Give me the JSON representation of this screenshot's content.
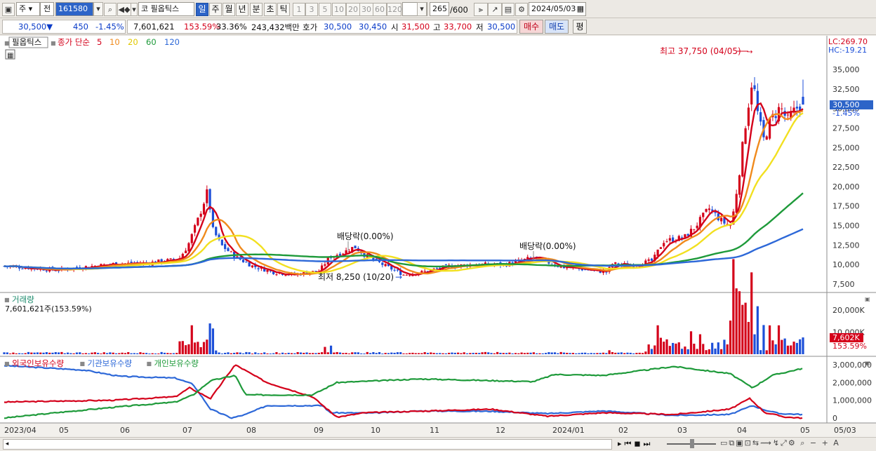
{
  "toolbar": {
    "market": "주",
    "mode": "전",
    "code": "161580",
    "market_tag": "코",
    "stock_name": "필옵틱스",
    "periods": [
      "일",
      "주",
      "월",
      "년",
      "분",
      "초",
      "틱"
    ],
    "active_period": "일",
    "intervals": [
      "1",
      "3",
      "5",
      "10",
      "20",
      "30",
      "60",
      "120"
    ],
    "count": "265",
    "count_total": "/600",
    "date": "2024/05/03"
  },
  "quote": {
    "price": "30,500",
    "arrow": "▼",
    "change": "450",
    "change_pct": "-1.45%",
    "volume": "7,601,621",
    "volume_ratio": "153.59%",
    "turnover": "33.36%",
    "amount": "243,432백만",
    "bid_label": "호가",
    "ask": "30,500",
    "bid": "30,450",
    "open_label": "시",
    "open": "31,500",
    "high_label": "고",
    "high": "33,700",
    "low_label": "저",
    "low": "30,500",
    "buy_label": "매수",
    "sell_label": "매도",
    "eval_label": "평"
  },
  "price_panel": {
    "title": "필옵틱스",
    "ma_label": "종가 단순",
    "ma_periods": [
      {
        "p": "5",
        "color": "#d4001a"
      },
      {
        "p": "10",
        "color": "#f08a1c"
      },
      {
        "p": "20",
        "color": "#e0c800"
      },
      {
        "p": "60",
        "color": "#1e9a3a"
      },
      {
        "p": "120",
        "color": "#2d68d8"
      }
    ],
    "lc": "LC:269.70",
    "hc": "HC:-19.21",
    "current_tag": "30,500",
    "current_pct": "-1.45%",
    "high_annot": "최고 37,750 (04/05)",
    "low_annot": "최저 8,250 (10/20)",
    "dividend1": "배당락(0.00%)",
    "dividend2": "배당락(0.00%)",
    "y_ticks": [
      "35,000",
      "32,500",
      "30,000",
      "27,500",
      "25,000",
      "22,500",
      "20,000",
      "17,500",
      "15,000",
      "12,500",
      "10,000",
      "7,500"
    ]
  },
  "volume_panel": {
    "title": "거래량",
    "subtitle": "7,601,621주(153.59%)",
    "y_ticks": [
      "20,000K",
      "10,000K"
    ],
    "tag": "7,602K",
    "tag_pct": "153.59%"
  },
  "holding_panel": {
    "legend": [
      {
        "label": "외국인보유수량",
        "color": "#d4001a"
      },
      {
        "label": "기관보유수량",
        "color": "#2d68d8"
      },
      {
        "label": "개인보유수량",
        "color": "#1e9a3a"
      }
    ],
    "y_ticks": [
      "3,000,000",
      "2,000,000",
      "1,000,000",
      "0"
    ]
  },
  "x_axis": [
    "2023/04",
    "05",
    "06",
    "07",
    "08",
    "09",
    "10",
    "11",
    "12",
    "2024/01",
    "02",
    "03",
    "04",
    "05",
    "05/03"
  ],
  "colors": {
    "up": "#d4001a",
    "down": "#1d4fd8",
    "ma5": "#d4001a",
    "ma10": "#f08a1c",
    "ma20": "#f2e020",
    "ma60": "#1e9a3a",
    "ma120": "#2d68d8"
  }
}
